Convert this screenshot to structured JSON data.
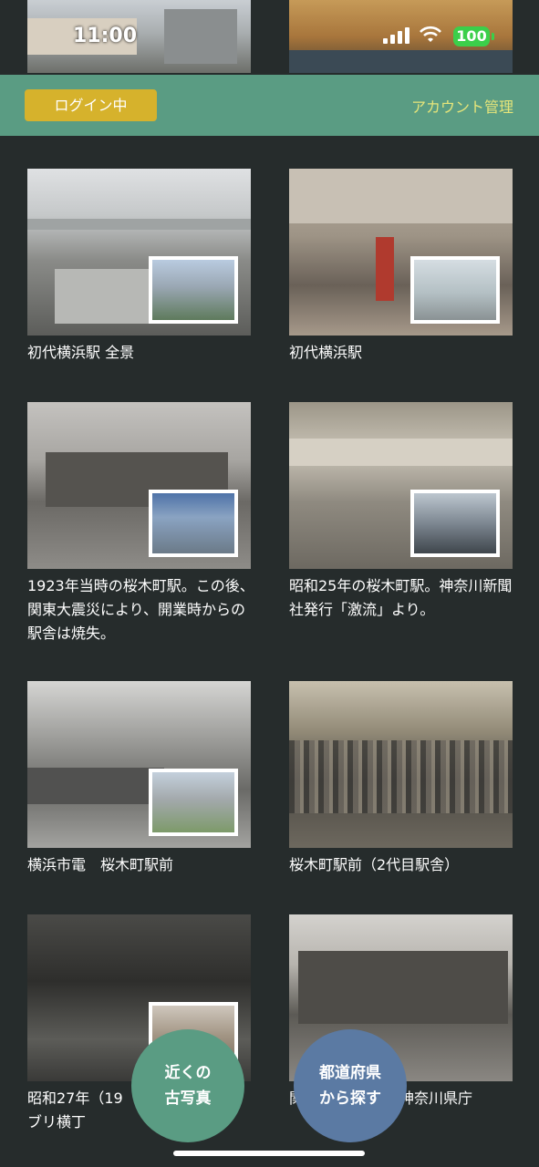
{
  "status": {
    "time": "11:00",
    "battery": "100"
  },
  "header": {
    "login_label": "ログイン中",
    "account_label": "アカウント管理"
  },
  "items": [
    {
      "caption": "初代横浜駅 全景"
    },
    {
      "caption": "初代横浜駅"
    },
    {
      "caption": "1923年当時の桜木町駅。この後、関東大震災により、開業時からの駅舎は焼失。"
    },
    {
      "caption": "昭和25年の桜木町駅。神奈川新聞社発行「激流」より。"
    },
    {
      "caption": "横浜市電　桜木町駅前"
    },
    {
      "caption": "桜木町駅前（2代目駅舎）"
    },
    {
      "caption_a": "昭和27年（19",
      "caption_b": "ブリ横丁"
    },
    {
      "caption_a": "関",
      "caption_b": "神奈川県庁"
    }
  ],
  "fab": {
    "nearby_line1": "近くの",
    "nearby_line2": "古写真",
    "pref_line1": "都道府県",
    "pref_line2": "から探す"
  },
  "colors": {
    "header": "#5a9c83",
    "login": "#d6b22c",
    "account": "#e6e57a",
    "fab_green": "#5a9c83",
    "fab_blue": "#5b7aa3",
    "background": "#262c2c"
  }
}
